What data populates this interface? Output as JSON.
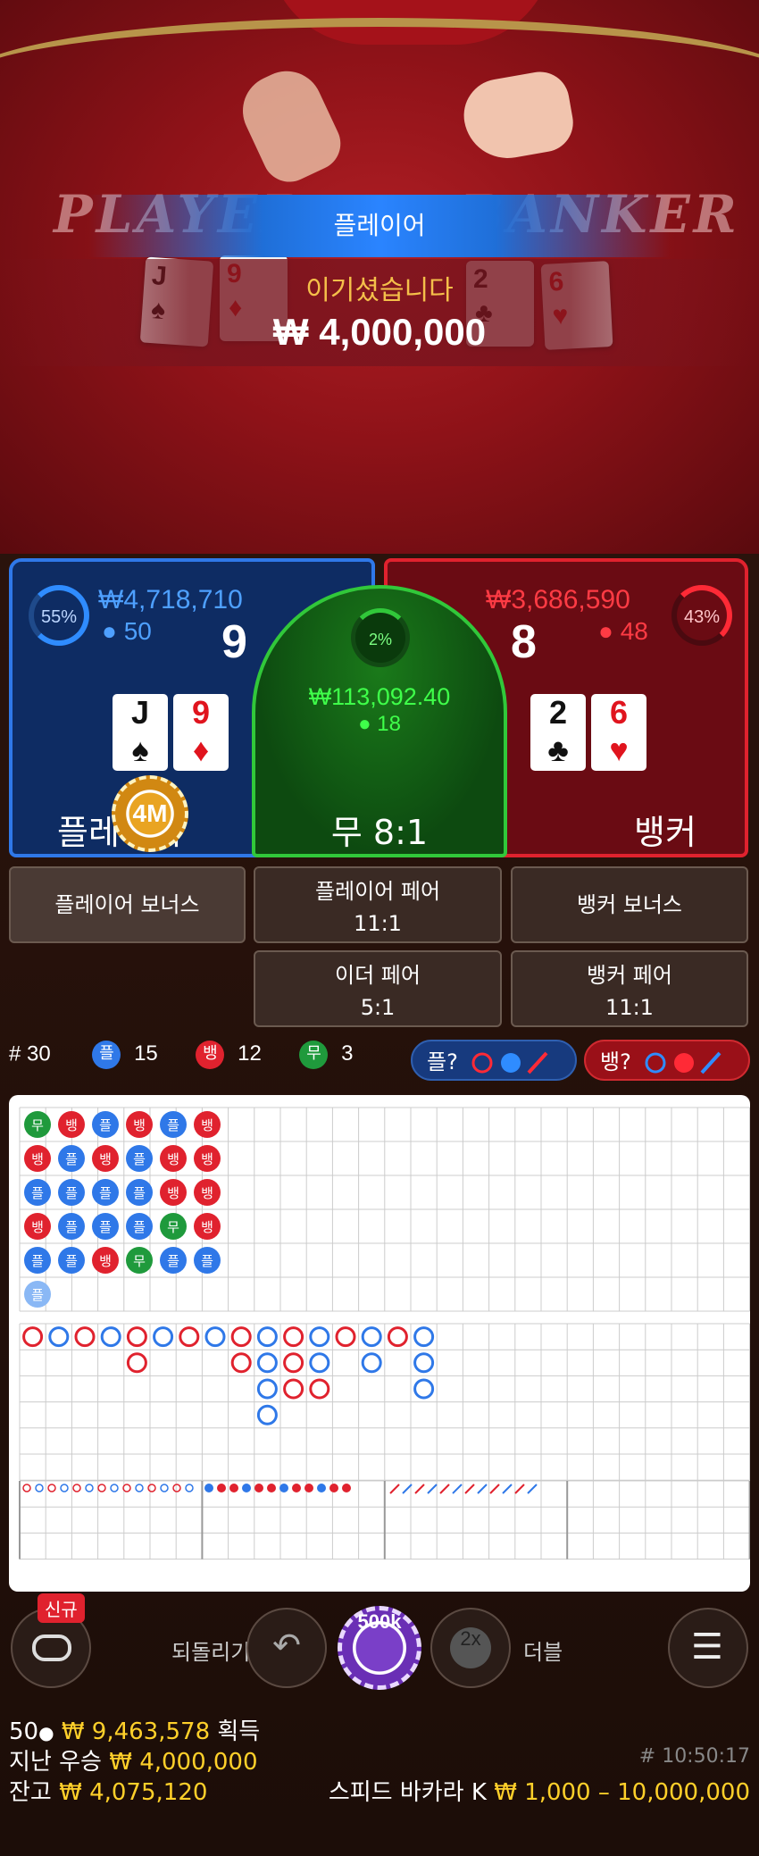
{
  "video": {
    "felt_left": "PLAYER",
    "felt_right": "BANKER",
    "win_side": "플레이어",
    "win_message": "이기셨습니다",
    "win_amount": "₩ 4,000,000",
    "player_cards": [
      {
        "rank": "J",
        "suit": "♠"
      },
      {
        "rank": "9",
        "suit": "♦"
      }
    ],
    "banker_cards": [
      {
        "rank": "2",
        "suit": "♣"
      },
      {
        "rank": "6",
        "suit": "♥"
      }
    ]
  },
  "player": {
    "percent": "55%",
    "amount": "₩4,718,710",
    "count": "50",
    "score": "9",
    "label": "플레이어",
    "cards": [
      {
        "rank": "J",
        "suit": "♠",
        "color": "#111111"
      },
      {
        "rank": "9",
        "suit": "♦",
        "color": "#e0141e"
      }
    ],
    "chip": "4M",
    "color": "#2f78e8"
  },
  "tie": {
    "percent": "2%",
    "amount": "₩113,092.40",
    "count": "18",
    "label": "무 8:1",
    "color": "#31c83a"
  },
  "banker": {
    "percent": "43%",
    "amount": "₩3,686,590",
    "count": "48",
    "score": "8",
    "label": "뱅커",
    "cards": [
      {
        "rank": "2",
        "suit": "♣",
        "color": "#111111"
      },
      {
        "rank": "6",
        "suit": "♥",
        "color": "#e0141e"
      }
    ],
    "color": "#e0222e"
  },
  "side_bets": {
    "player_bonus": "플레이어 보너스",
    "player_pair": "플레이어 페어",
    "player_pair_odds": "11:1",
    "banker_bonus": "뱅커 보너스",
    "either_pair": "이더 페어",
    "either_pair_odds": "5:1",
    "banker_pair": "뱅커 페어",
    "banker_pair_odds": "11:1"
  },
  "stats": {
    "round": "# 30",
    "player_icon": "플",
    "player_count": "15",
    "banker_icon": "뱅",
    "banker_count": "12",
    "tie_icon": "무",
    "tie_count": "3",
    "predict_player": "플?",
    "predict_banker": "뱅?"
  },
  "bead_road": [
    [
      "무",
      "뱅",
      "플",
      "뱅",
      "플",
      "플"
    ],
    [
      "뱅",
      "플",
      "플",
      "플",
      "플"
    ],
    [
      "플",
      "뱅",
      "플",
      "플",
      "뱅"
    ],
    [
      "뱅",
      "플",
      "플",
      "플",
      "무"
    ],
    [
      "플",
      "뱅",
      "뱅",
      "무",
      "플"
    ],
    [
      "뱅",
      "뱅",
      "뱅",
      "뱅",
      "플"
    ]
  ],
  "controls": {
    "new_badge": "신규",
    "undo_label": "되돌리기",
    "chip_value": "500k",
    "double_icon": "2x",
    "double_label": "더블"
  },
  "footer": {
    "players": "50",
    "total_won": "₩ 9,463,578",
    "total_won_suffix": "획득",
    "last_win_label": "지난 우승",
    "last_win_value": "₩ 4,000,000",
    "balance_label": "잔고",
    "balance_value": "₩ 4,075,120",
    "time": "# 10:50:17",
    "table_name": "스피드 바카라 K",
    "limits": "₩ 1,000 – 10,000,000"
  },
  "colors": {
    "player": "#2f78e8",
    "banker": "#e0222e",
    "tie": "#1f9a3c",
    "accent": "#ffd02a"
  }
}
